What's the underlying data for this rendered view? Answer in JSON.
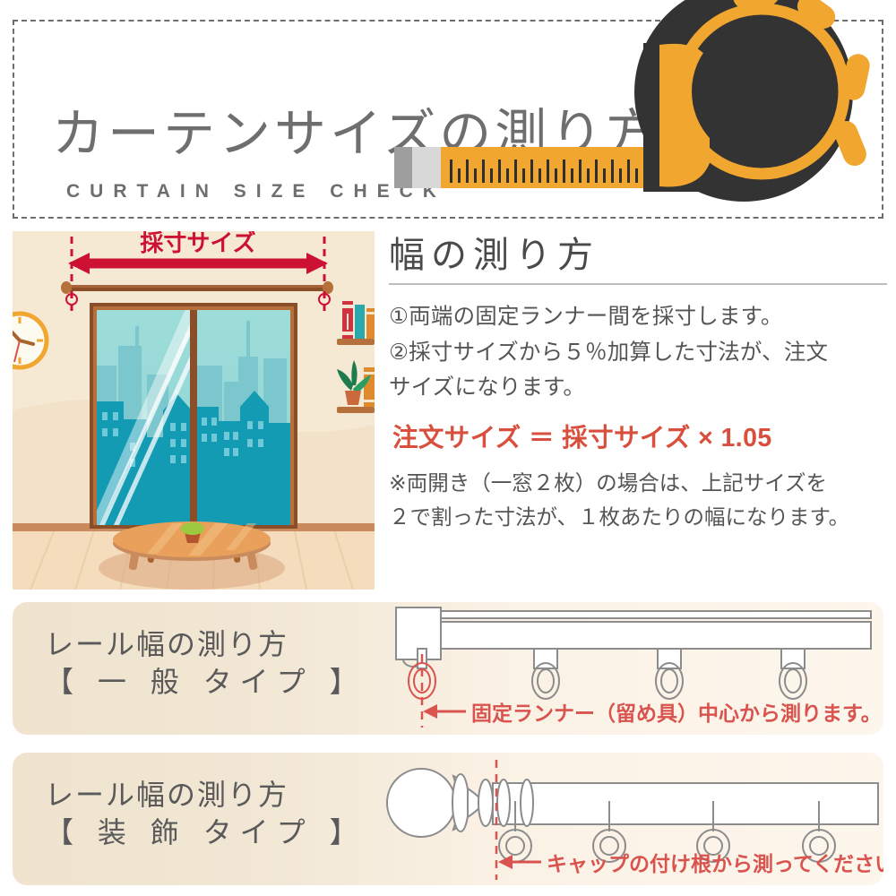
{
  "header": {
    "title": "カーテンサイズの測り方",
    "subtitle": "CURTAIN SIZE CHECK",
    "icon": "tape-measure-icon",
    "border_style": "dashed",
    "border_color": "#6e6e6e",
    "title_color": "#6e6e6e"
  },
  "room_illustration": {
    "measure_label": "採寸サイズ",
    "measure_label_color": "#cc1133",
    "arrow_color": "#cc1133",
    "objects": [
      "wall-clock-icon",
      "curtain-rail",
      "fixed-runner",
      "window-frame",
      "city-skyline",
      "bookshelf",
      "potted-plant",
      "low-table",
      "wood-floor"
    ],
    "colors": {
      "wall": "#f5e7d0",
      "floor": "#f3d9bb",
      "sky": "#9ddcd9",
      "building_far": "#7cc7cd",
      "building_near": "#139bb4",
      "frame": "#9b5a32"
    }
  },
  "width_panel": {
    "title": "幅の測り方",
    "steps": [
      "①両端の固定ランナー間を採寸します。",
      "②採寸サイズから５％加算した寸法が、注文",
      "サイズになります。"
    ],
    "formula": "注文サイズ ＝ 採寸サイズ × 1.05",
    "formula_color": "#d94f3d",
    "note": [
      "※両開き（一窓２枚）の場合は、上記サイズを",
      "２で割った寸法が、１枚あたりの幅になります。"
    ]
  },
  "rail_sections": [
    {
      "id": "general",
      "label_line1": "レール幅の測り方",
      "label_line2": "【 一 般 タイプ 】",
      "caption": "固定ランナー（留め具）中心から測ります。",
      "caption_color": "#d9534f",
      "art": "general-curtain-rail",
      "runner_count": 4,
      "highlighted_runner_index": 0
    },
    {
      "id": "decor",
      "label_line1": "レール幅の測り方",
      "label_line2": "【 装 飾 タイプ 】",
      "caption": "キャップの付け根から測ってください。",
      "caption_color": "#d9534f",
      "art": "decorative-curtain-rod",
      "ring_count": 4,
      "highlighted_runner_index": 0
    }
  ],
  "palette": {
    "cream_bg": "#f1e6d3",
    "cream_bg_light": "#fdf6ec",
    "accent_red": "#cc1133",
    "accent_orange": "#f0a62f",
    "dark": "#333333",
    "gray_text": "#6e6e6e"
  }
}
